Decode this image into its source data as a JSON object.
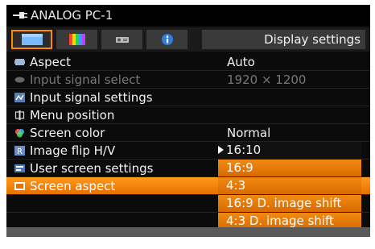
{
  "title": {
    "text": "ANALOG PC-1",
    "icon": "plug-icon"
  },
  "tabs": [
    {
      "name": "display",
      "icon": "display-settings-icon",
      "active": true
    },
    {
      "name": "color",
      "icon": "color-bars-icon",
      "active": false
    },
    {
      "name": "install",
      "icon": "projector-icon",
      "active": false
    },
    {
      "name": "info",
      "icon": "info-icon",
      "active": false
    }
  ],
  "tab_title": "Display settings",
  "menu": [
    {
      "label": "Aspect",
      "value": "Auto",
      "icon": "aspect-icon",
      "state": "normal"
    },
    {
      "label": "Input signal select",
      "value": "1920 × 1200",
      "icon": "input-signal-icon",
      "state": "disabled"
    },
    {
      "label": "Input signal settings",
      "value": "",
      "icon": "signal-settings-icon",
      "state": "normal"
    },
    {
      "label": "Menu position",
      "value": "",
      "icon": "menu-position-icon",
      "state": "normal"
    },
    {
      "label": "Screen color",
      "value": "Normal",
      "icon": "screen-color-icon",
      "state": "normal"
    },
    {
      "label": "Image flip H/V",
      "value": "",
      "icon": "image-flip-icon",
      "state": "normal"
    },
    {
      "label": "User screen settings",
      "value": "",
      "icon": "user-screen-icon",
      "state": "normal"
    },
    {
      "label": "Screen aspect",
      "value": "",
      "icon": "screen-aspect-icon",
      "state": "selected"
    }
  ],
  "screen_aspect_options": [
    {
      "label": "16:10",
      "current": true
    },
    {
      "label": "16:9",
      "current": false
    },
    {
      "label": "4:3",
      "current": false
    },
    {
      "label": "16:9 D. image shift",
      "current": false
    },
    {
      "label": "4:3 D. image shift",
      "current": false
    }
  ],
  "colors": {
    "accent_orange": "#ff8a00",
    "background": "#0b0b0b",
    "text": "#f2f2f2",
    "disabled_text": "#777777"
  }
}
